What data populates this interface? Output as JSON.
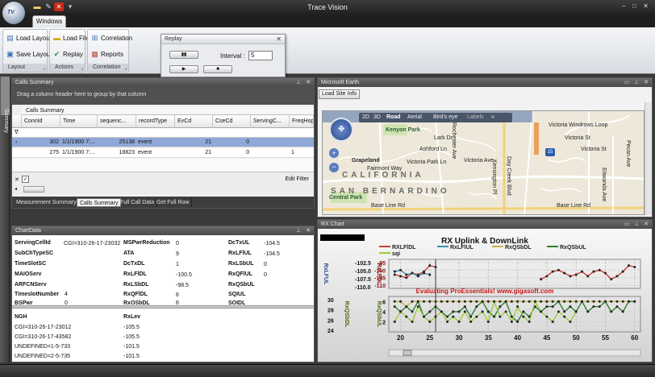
{
  "app": {
    "title": "Trace Vision",
    "orb_text": "TV",
    "tab": "Windows"
  },
  "ribbon": {
    "layout_group": {
      "label": "Layout",
      "load_layout": "Load Layout",
      "save_layout": "Save Layout"
    },
    "actions_group": {
      "label": "Actions",
      "load_file": "Load File",
      "replay": "Replay"
    },
    "correlation_group": {
      "label": "Correlation",
      "correlation": "Correlation",
      "reports": "Reports"
    }
  },
  "replay_window": {
    "title": "Replay",
    "interval_label": "Interval :",
    "interval_value": "5"
  },
  "side_strip": {
    "label": "Summary"
  },
  "calls_summary": {
    "title": "Calls Summary",
    "group_hint": "Drag a column header here to group by that column",
    "band": "Calls Summary",
    "filter_icon": "∇",
    "columns": [
      "ConnId",
      "Time",
      "sequenc...",
      "recordType",
      "EvCd",
      "CseCd",
      "ServingC...",
      "FreqHop"
    ],
    "rows": [
      {
        "marker": "›",
        "connid": "302",
        "time": "1/1/1900 7:...",
        "seq": "25138",
        "rectype": "event",
        "evcd": "21",
        "csecd": "0",
        "serving": "",
        "freqhop": ""
      },
      {
        "marker": "",
        "connid": "275",
        "time": "1/1/1900 7:...",
        "seq": "18823",
        "rectype": "event",
        "evcd": "21",
        "csecd": "0",
        "serving": "",
        "freqhop": "1"
      }
    ],
    "edit_filter": "Edit Filter",
    "tabs": [
      "Measurement Summary",
      "Calls Summary",
      "Full Call Data",
      "Get Full Row"
    ]
  },
  "chart_data_panel": {
    "title": "ChartData",
    "col1": [
      {
        "key": "ServingCellId",
        "value": "CGI=310-26-17-23032"
      },
      {
        "key": "SubChTypeSC",
        "value": ""
      },
      {
        "key": "TimeSlotSC",
        "value": ""
      },
      {
        "key": "MAIOServ",
        "value": ""
      },
      {
        "key": "ARFCNServ",
        "value": ""
      },
      {
        "key": "TimeslotNumber",
        "value": "4"
      },
      {
        "key": "BSPwr",
        "value": "0"
      }
    ],
    "col2": [
      {
        "key": "MSPwrReduction",
        "value": "0"
      },
      {
        "key": "ATA",
        "value": "9"
      },
      {
        "key": "DcTxDL",
        "value": "1"
      },
      {
        "key": "RxLFlDL",
        "value": "-100.5"
      },
      {
        "key": "RxLSbDL",
        "value": "-98.5"
      },
      {
        "key": "RxQFlDL",
        "value": "6"
      },
      {
        "key": "RxQSbDL",
        "value": "6"
      }
    ],
    "col3": [
      {
        "key": "DcTxUL",
        "value": "-104.5"
      },
      {
        "key": "RxLFlUL",
        "value": "-104.5"
      },
      {
        "key": "RxLSbUL",
        "value": "0"
      },
      {
        "key": "RxQFlUL",
        "value": "0"
      },
      {
        "key": "RxQSbUL",
        "value": ""
      },
      {
        "key": "SQIUL",
        "value": ""
      },
      {
        "key": "SQIDL",
        "value": ""
      }
    ],
    "ngh_header": "NGH",
    "rxlev_header": "RxLev",
    "ngh_rows": [
      {
        "ngh": "CGI=310-26-17-23012",
        "rxlev": "-105.5"
      },
      {
        "ngh": "CGI=310-26-17-43582",
        "rxlev": "-105.5"
      },
      {
        "ngh": "UNDEFINED=1-5-733",
        "rxlev": "-101.5"
      },
      {
        "ngh": "UNDEFINED=2-5-735",
        "rxlev": "-101.5"
      }
    ]
  },
  "earth_panel": {
    "title": "Microsoft Earth",
    "load_site_info": "Load Site Info",
    "map_toolbar": [
      "2D",
      "3D",
      "Road",
      "Aerial",
      "Bird's eye",
      "Labels",
      "«"
    ],
    "labels": {
      "kenyon_park": "Kenyon Park",
      "grapeland": "Grapeland",
      "california": "CALIFORNIA",
      "san_bernardino": "SAN BERNARDINO",
      "central_park": "Central Park",
      "victoria_park_ln": "Victoria Park Ln",
      "victoria_ave": "Victoria Ave",
      "base_line_rd": "Base Line Rd",
      "fairmont_way": "Fairmont Way",
      "lark_dr": "Lark Dr",
      "ashford_ln": "Ashford Ln",
      "victoria_windrows_loop": "Victoria Windrows Loop",
      "rochester_ave": "Rochester Ave",
      "kensington_pl": "Kensington Pl",
      "day_creek_blvd": "Day Creek Blvd",
      "pecan_ave": "Pecan Ave",
      "etiwanda_ave": "Etiwanda Ave",
      "victoria_st": "Victoria St",
      "i15": "15"
    }
  },
  "rx_panel": {
    "title": "RX Chart"
  },
  "chart_data": {
    "type": "line",
    "title": "RX Uplink & DownLink",
    "watermark": "Evaluating ProEssentials! www.gigasoft.com",
    "x_ticks": [
      20,
      25,
      30,
      35,
      40,
      45,
      50,
      55,
      60
    ],
    "xlim": [
      18,
      61
    ],
    "top_panel": {
      "ylabels": [
        "RxLFUL",
        "RxLFDL"
      ],
      "left_ticks": [
        -102.5,
        -105.0,
        -107.5,
        -110.0
      ],
      "right_ticks": [
        -95,
        -100,
        -105,
        -110
      ],
      "ylim": [
        -112,
        -93
      ],
      "series": [
        {
          "name": "RXLFlDL",
          "color": "#d23a32",
          "x": [
            19,
            20,
            21,
            22,
            23,
            24,
            25,
            26
          ],
          "y": [
            -103,
            -104,
            -105,
            -102,
            -103,
            -101,
            -97,
            -98
          ]
        },
        {
          "name": "RxLFlUL",
          "color": "#3a8fb0",
          "x": [
            19,
            20,
            21,
            22,
            23,
            24,
            25
          ],
          "y": [
            -101,
            -100,
            -103,
            -102,
            -104,
            -102,
            -103
          ]
        },
        {
          "name": "RXLFlDL",
          "color": "#d23a32",
          "x": [
            44,
            45,
            46,
            47,
            48,
            49,
            50,
            51,
            52,
            53,
            54,
            55,
            56,
            57,
            58,
            59,
            60
          ],
          "y": [
            -106,
            -104,
            -101,
            -100,
            -102,
            -104,
            -103,
            -101,
            -104,
            -101,
            -100,
            -102,
            -106,
            -104,
            -101,
            -97,
            -98
          ]
        }
      ]
    },
    "bottom_panel": {
      "ylabels": [
        "RxQSbDL",
        "RxQSbUL"
      ],
      "left_ticks": [
        30,
        28,
        26,
        24
      ],
      "right_ticks": [
        6,
        4,
        2
      ],
      "ylim": [
        0,
        7
      ],
      "legend": [
        "RXLFlDL",
        "RxLFlUL",
        "RxQSbDL",
        "RxQSbUL",
        "sqi"
      ],
      "legend_colors": [
        "#d23a32",
        "#3a8fb0",
        "#c6b24a",
        "#2e7d32",
        "#9ccc3a"
      ],
      "series": [
        {
          "name": "RxQSbDL",
          "color": "#c6b24a",
          "x": [
            19,
            20,
            21,
            22,
            23,
            24,
            25,
            26,
            27,
            28,
            29,
            30,
            31,
            32,
            33,
            34,
            35,
            36,
            37,
            38,
            39,
            40,
            41,
            42,
            43,
            44,
            45,
            46,
            47,
            48,
            49,
            50,
            51,
            52,
            53,
            54,
            55,
            56,
            57,
            58,
            59,
            60
          ],
          "y": [
            6,
            6,
            5,
            6,
            6,
            6,
            6,
            6,
            6,
            6,
            6,
            6,
            6,
            6,
            6,
            6,
            6,
            6,
            6,
            6,
            6,
            6,
            6,
            6,
            6,
            6,
            6,
            6,
            6,
            6,
            6,
            6,
            6,
            6,
            6,
            6,
            6,
            6,
            6,
            6,
            6,
            6
          ]
        },
        {
          "name": "RxQSbUL",
          "color": "#2e7d32",
          "x": [
            19,
            20,
            21,
            22,
            23,
            24,
            25,
            26,
            27,
            28,
            29,
            30,
            31,
            32,
            33,
            34,
            35,
            36,
            37,
            38,
            39,
            40,
            41,
            42,
            43,
            44,
            45,
            46,
            47,
            48,
            49,
            50,
            51,
            52,
            53,
            54,
            55,
            56,
            57,
            58,
            59,
            60
          ],
          "y": [
            5,
            4,
            5,
            4,
            6,
            3,
            4,
            5,
            4,
            3,
            4,
            4,
            5,
            3,
            5,
            6,
            4,
            3,
            5,
            6,
            3,
            2,
            4,
            3,
            5,
            4,
            5,
            5,
            6,
            4,
            5,
            4,
            6,
            4,
            5,
            5,
            6,
            4,
            5,
            4,
            6,
            6
          ]
        },
        {
          "name": "sqi",
          "color": "#9ccc3a",
          "x": [
            19,
            20,
            21,
            22,
            23,
            24,
            25,
            26,
            27,
            28,
            29,
            30,
            31,
            32,
            33,
            34,
            35,
            36,
            37,
            38,
            39,
            40,
            41,
            42,
            43,
            44,
            45,
            46,
            47,
            48,
            49,
            50
          ],
          "y": [
            2,
            4,
            3,
            2,
            5,
            3,
            2,
            3,
            4,
            2,
            3,
            2,
            4,
            2,
            3,
            4,
            2,
            6,
            3,
            4,
            2,
            5,
            3,
            2,
            6,
            4,
            3,
            2,
            4,
            3,
            2,
            4
          ]
        }
      ]
    }
  }
}
